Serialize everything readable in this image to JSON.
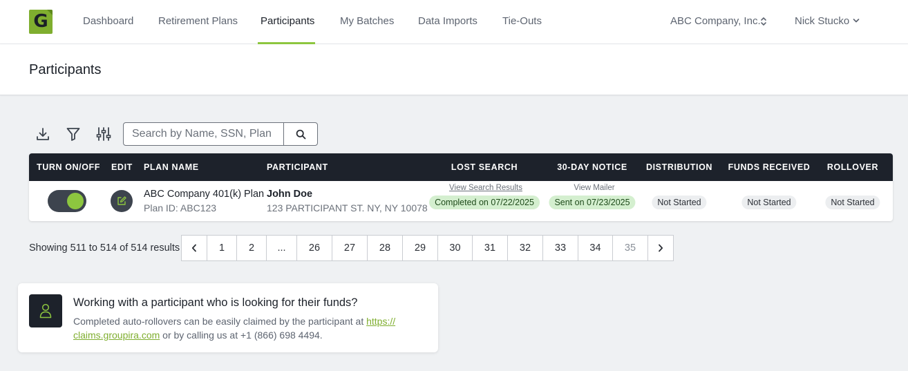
{
  "nav": {
    "logo_letter": "G",
    "links": [
      "Dashboard",
      "Retirement Plans",
      "Participants",
      "My Batches",
      "Data Imports",
      "Tie-Outs"
    ],
    "active_index": 2,
    "company": "ABC Company, Inc.",
    "user": "Nick Stucko",
    "accent_color": "#8dc63f"
  },
  "page": {
    "title": "Participants"
  },
  "toolbar": {
    "icons": [
      "download-icon",
      "filter-icon",
      "sliders-icon"
    ],
    "search_placeholder": "Search by Name, SSN, Plan",
    "search_value": "",
    "search_button_icon": "search-icon"
  },
  "table": {
    "columns": [
      "TURN ON/OFF",
      "EDIT",
      "PLAN NAME",
      "PARTICIPANT",
      "LOST SEARCH",
      "30-DAY NOTICE",
      "DISTRIBUTION",
      "FUNDS RECEIVED",
      "ROLLOVER"
    ],
    "rows": [
      {
        "enabled": true,
        "plan_name": "ABC Company 401(k) Plan",
        "plan_id": "Plan ID: ABC123",
        "participant_name": "John Doe",
        "participant_address": "123 PARTICIPANT ST. NY, NY 10078",
        "lost_search_link": "View Search Results",
        "lost_search_status": "Completed on 07/22/2025",
        "notice_link": "View Mailer",
        "notice_status": "Sent on 07/23/2025",
        "distribution": "Not Started",
        "funds_received": "Not Started",
        "rollover": "Not Started"
      }
    ]
  },
  "pagination": {
    "summary": "Showing 511 to 514 of 514 results",
    "pages": [
      "1",
      "2",
      "...",
      "26",
      "27",
      "28",
      "29",
      "30",
      "31",
      "32",
      "33",
      "34",
      "35"
    ],
    "current": "35"
  },
  "help": {
    "icon": "person-icon",
    "title": "Working with a participant who is looking for their funds?",
    "body_before": "Completed auto-rollovers can be easily claimed by the participant at ",
    "link_line1": "https://",
    "link_line2": "claims.groupira.com",
    "body_after": " or by calling us at +1 (866) 698 4494."
  }
}
